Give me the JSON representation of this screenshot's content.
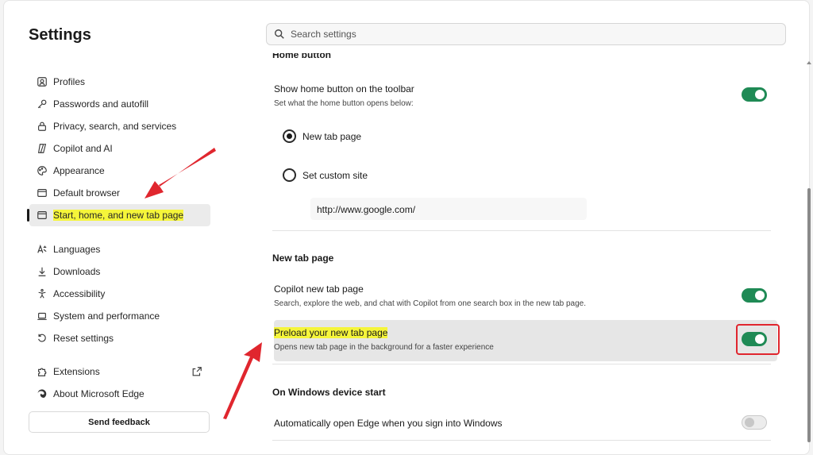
{
  "sidebar": {
    "title": "Settings",
    "items": [
      {
        "label": "Profiles",
        "icon": "profile-icon"
      },
      {
        "label": "Passwords and autofill",
        "icon": "key-icon"
      },
      {
        "label": "Privacy, search, and services",
        "icon": "lock-icon"
      },
      {
        "label": "Copilot and AI",
        "icon": "copilot-icon"
      },
      {
        "label": "Appearance",
        "icon": "appearance-icon"
      },
      {
        "label": "Default browser",
        "icon": "browser-icon"
      },
      {
        "label": "Start, home, and new tab page",
        "icon": "home-icon"
      },
      {
        "label": "Languages",
        "icon": "languages-icon"
      },
      {
        "label": "Downloads",
        "icon": "download-icon"
      },
      {
        "label": "Accessibility",
        "icon": "accessibility-icon"
      },
      {
        "label": "System and performance",
        "icon": "laptop-icon"
      },
      {
        "label": "Reset settings",
        "icon": "reset-icon"
      },
      {
        "label": "Extensions",
        "icon": "puzzle-icon"
      },
      {
        "label": "About Microsoft Edge",
        "icon": "edge-icon"
      }
    ],
    "feedback_label": "Send feedback"
  },
  "search": {
    "placeholder": "Search settings"
  },
  "home_button": {
    "heading": "Home button",
    "show_title": "Show home button on the toolbar",
    "show_desc": "Set what the home button opens below:",
    "option_new_tab": "New tab page",
    "option_custom": "Set custom site",
    "custom_url": "http://www.google.com/"
  },
  "new_tab": {
    "heading": "New tab page",
    "copilot_title": "Copilot new tab page",
    "copilot_desc": "Search, explore the web, and chat with Copilot from one search box in the new tab page.",
    "preload_title": "Preload your new tab page",
    "preload_desc": "Opens new tab page in the background for a faster experience"
  },
  "windows_start": {
    "heading": "On Windows device start",
    "auto_open_title": "Automatically open Edge when you sign into Windows"
  },
  "colors": {
    "accent": "#1f8a55",
    "highlight": "#f5f53a",
    "annotation_red": "#e0262e"
  }
}
